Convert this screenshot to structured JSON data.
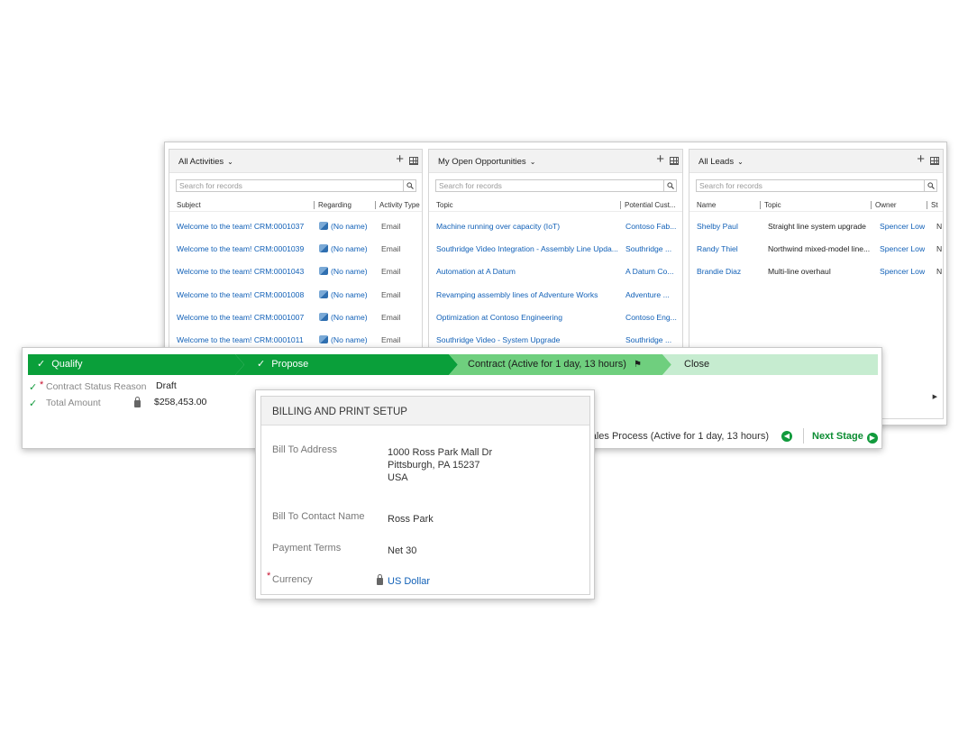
{
  "activities": {
    "title": "All Activities",
    "search_placeholder": "Search for records",
    "columns": [
      "Subject",
      "Regarding",
      "Activity Type"
    ],
    "rows": [
      {
        "subject": "Welcome to the team! CRM:0001037",
        "regarding": "(No name)",
        "type": "Email"
      },
      {
        "subject": "Welcome to the team! CRM:0001039",
        "regarding": "(No name)",
        "type": "Email"
      },
      {
        "subject": "Welcome to the team! CRM:0001043",
        "regarding": "(No name)",
        "type": "Email"
      },
      {
        "subject": "Welcome to the team! CRM:0001008",
        "regarding": "(No name)",
        "type": "Email"
      },
      {
        "subject": "Welcome to the team! CRM:0001007",
        "regarding": "(No name)",
        "type": "Email"
      },
      {
        "subject": "Welcome to the team! CRM:0001011",
        "regarding": "(No name)",
        "type": "Email"
      }
    ]
  },
  "opportunities": {
    "title": "My Open Opportunities",
    "search_placeholder": "Search for records",
    "columns": [
      "Topic",
      "Potential Cust..."
    ],
    "rows": [
      {
        "topic": "Machine running over capacity (IoT)",
        "customer": "Contoso Fab..."
      },
      {
        "topic": "Southridge Video Integration - Assembly Line Upda...",
        "customer": "Southridge ..."
      },
      {
        "topic": "Automation at A Datum",
        "customer": "A Datum Co..."
      },
      {
        "topic": "Revamping assembly lines of Adventure Works",
        "customer": "Adventure ..."
      },
      {
        "topic": "Optimization at Contoso Engineering",
        "customer": "Contoso Eng..."
      },
      {
        "topic": "Southridge Video - System Upgrade",
        "customer": "Southridge ..."
      }
    ]
  },
  "leads": {
    "title": "All Leads",
    "search_placeholder": "Search for records",
    "columns": [
      "Name",
      "Topic",
      "Owner",
      "St"
    ],
    "rows": [
      {
        "name": "Shelby Paul",
        "topic": "Straight line system upgrade",
        "owner": "Spencer Low",
        "st": "N"
      },
      {
        "name": "Randy Thiel",
        "topic": "Northwind mixed-model line...",
        "owner": "Spencer Low",
        "st": "N"
      },
      {
        "name": "Brandie Diaz",
        "topic": "Multi-line overhaul",
        "owner": "Spencer Low",
        "st": "N"
      }
    ]
  },
  "process": {
    "stages": [
      {
        "label": "Qualify",
        "status": "completed"
      },
      {
        "label": "Propose",
        "status": "completed"
      },
      {
        "label": "Contract (Active for 1 day, 13 hours)",
        "status": "active"
      },
      {
        "label": "Close",
        "status": "upcoming"
      }
    ],
    "fields": [
      {
        "label": "Contract Status Reason",
        "value": "Draft",
        "required": true
      },
      {
        "label": "Total Amount",
        "value": "$258,453.00",
        "locked": true
      }
    ],
    "process_info": "Sales Process (Active for 1 day, 13 hours)",
    "next_stage_label": "Next Stage"
  },
  "billing": {
    "title": "BILLING AND PRINT SETUP",
    "fields": [
      {
        "label": "Bill To Address",
        "lines": [
          "1000 Ross Park Mall Dr",
          "Pittsburgh, PA 15237",
          "USA"
        ]
      },
      {
        "label": "Bill To Contact Name",
        "value": "Ross Park"
      },
      {
        "label": "Payment Terms",
        "value": "Net 30"
      },
      {
        "label": "Currency",
        "value": "US Dollar",
        "required": true,
        "locked": true
      }
    ]
  },
  "colors": {
    "stage_complete": "#0a9f3a",
    "stage_active": "#6fcf7e",
    "stage_upcoming": "#c6ecd0",
    "link": "#1160b7"
  }
}
